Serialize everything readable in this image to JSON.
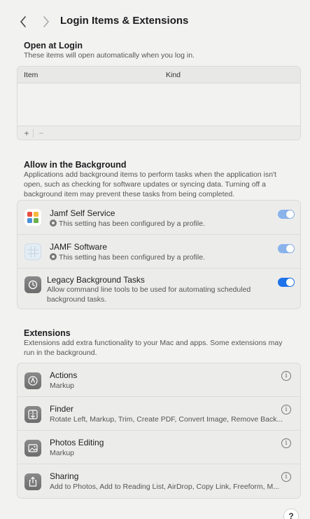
{
  "header": {
    "title": "Login Items & Extensions"
  },
  "open_at_login": {
    "title": "Open at Login",
    "desc": "These items will open automatically when you log in.",
    "columns": {
      "item": "Item",
      "kind": "Kind"
    },
    "add_label": "+",
    "remove_label": "−"
  },
  "background": {
    "title": "Allow in the Background",
    "desc": "Applications add background items to perform tasks when the application isn't open, such as checking for software updates or syncing data. Turning off a background item may prevent these tasks from being completed.",
    "items": [
      {
        "name": "Jamf Self Service",
        "sub": "This setting has been configured by a profile.",
        "enabled": true,
        "managed": true
      },
      {
        "name": "JAMF Software",
        "sub": "This setting has been configured by a profile.",
        "enabled": true,
        "managed": true
      },
      {
        "name": "Legacy Background Tasks",
        "sub": "Allow command line tools to be used for automating scheduled background tasks.",
        "enabled": true,
        "managed": false
      }
    ]
  },
  "extensions": {
    "title": "Extensions",
    "desc": "Extensions add extra functionality to your Mac and apps. Some extensions may run in the background.",
    "items": [
      {
        "name": "Actions",
        "sub": "Markup",
        "icon": "actions-icon"
      },
      {
        "name": "Finder",
        "sub": "Rotate Left, Markup, Trim, Create PDF, Convert Image, Remove Back...",
        "icon": "finder-icon"
      },
      {
        "name": "Photos Editing",
        "sub": "Markup",
        "icon": "photos-icon"
      },
      {
        "name": "Sharing",
        "sub": "Add to Photos, Add to Reading List, AirDrop, Copy Link, Freeform, M...",
        "icon": "share-icon"
      }
    ],
    "info_label": "i"
  },
  "help": {
    "label": "?"
  },
  "colors": {
    "accent": "#1e73ea",
    "managed_toggle": "#8ab3ec",
    "background": "#f2f2f1"
  }
}
